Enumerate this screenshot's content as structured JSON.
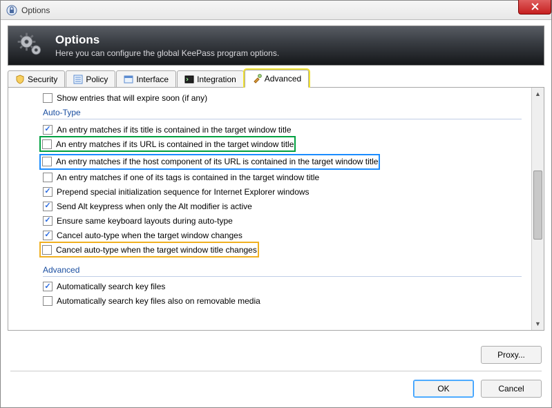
{
  "window": {
    "title": "Options"
  },
  "banner": {
    "title": "Options",
    "subtitle": "Here you can configure the global KeePass program options."
  },
  "tabs": [
    {
      "label": "Security"
    },
    {
      "label": "Policy"
    },
    {
      "label": "Interface"
    },
    {
      "label": "Integration"
    },
    {
      "label": "Advanced"
    }
  ],
  "toprow": {
    "label": "Show entries that will expire soon (if any)",
    "checked": false
  },
  "groups": {
    "autotype": {
      "title": "Auto-Type",
      "items": [
        {
          "label": "An entry matches if its title is contained in the target window title",
          "checked": true
        },
        {
          "label": "An entry matches if its URL is contained in the target window title",
          "checked": false,
          "box": "green"
        },
        {
          "label": "An entry matches if the host component of its URL is contained in the target window title",
          "checked": false,
          "box": "blue"
        },
        {
          "label": "An entry matches if one of its tags is contained in the target window title",
          "checked": false
        },
        {
          "label": "Prepend special initialization sequence for Internet Explorer windows",
          "checked": true
        },
        {
          "label": "Send Alt keypress when only the Alt modifier is active",
          "checked": true
        },
        {
          "label": "Ensure same keyboard layouts during auto-type",
          "checked": true
        },
        {
          "label": "Cancel auto-type when the target window changes",
          "checked": true
        },
        {
          "label": "Cancel auto-type when the target window title changes",
          "checked": false,
          "box": "orange"
        }
      ]
    },
    "advanced": {
      "title": "Advanced",
      "items": [
        {
          "label": "Automatically search key files",
          "checked": true
        },
        {
          "label": "Automatically search key files also on removable media",
          "checked": false
        }
      ]
    }
  },
  "buttons": {
    "proxy": "Proxy...",
    "ok": "OK",
    "cancel": "Cancel"
  }
}
